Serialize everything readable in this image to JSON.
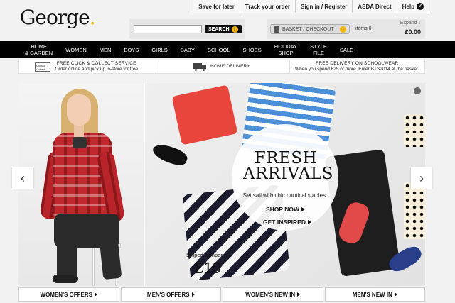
{
  "utility_links": [
    "Save for later",
    "Track your order",
    "Sign in / Register",
    "ASDA Direct",
    "Help"
  ],
  "logo": {
    "text": "George",
    "dot": "."
  },
  "search": {
    "placeholder": "",
    "button_label": "SEARCH"
  },
  "basket": {
    "button_label": "BASKET / CHECKOUT",
    "items": "items:0",
    "expand": "Expand ↓",
    "total": "£0.00"
  },
  "nav": [
    "HOME\n& GARDEN",
    "WOMEN",
    "MEN",
    "BOYS",
    "GIRLS",
    "BABY",
    "SCHOOL",
    "SHOES",
    "HOLIDAY\nSHOP",
    "STYLE\nFILE",
    "SALE"
  ],
  "services": {
    "click_collect_icon": "Click & Collect",
    "click_collect_title": "FREE CLICK & COLLECT SERVICE",
    "click_collect_sub": "Order online and pick up in-store for free",
    "delivery": "HOME DELIVERY",
    "schoolwear_title": "FREE DELIVERY ON SCHOOLWEAR",
    "schoolwear_sub": "When you spend £25 or more. Enter BTS2014 at the basket."
  },
  "hero": {
    "title": "FRESH\nARRIVALS",
    "subtitle": "Set sail with chic nautical staples.",
    "shop_now": "SHOP NOW",
    "get_inspired": "GET INSPIRED",
    "price_caption": "Striped Jumper",
    "price": "£10"
  },
  "carousel": {
    "prev": "‹",
    "next": "›"
  },
  "offers": [
    "WOMEN'S OFFERS",
    "MEN'S OFFERS",
    "WOMEN'S NEW IN",
    "MEN'S NEW IN"
  ],
  "colors": {
    "accent": "#f5b400",
    "nav_bg": "#000000"
  }
}
